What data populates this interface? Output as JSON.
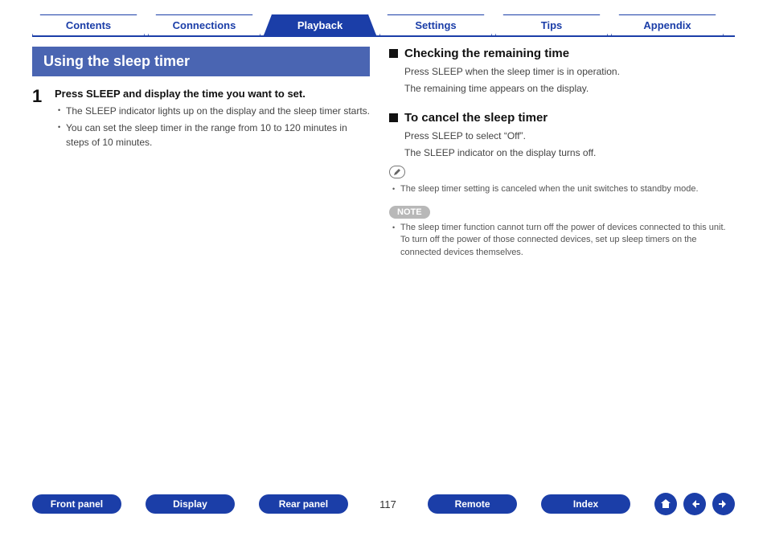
{
  "tabs": {
    "contents": "Contents",
    "connections": "Connections",
    "playback": "Playback",
    "settings": "Settings",
    "tips": "Tips",
    "appendix": "Appendix",
    "active": "playback"
  },
  "left": {
    "section_title": "Using the sleep timer",
    "step1": {
      "num": "1",
      "title": "Press SLEEP and display the time you want to set.",
      "bullets": [
        "The SLEEP indicator lights up on the display and the sleep timer starts.",
        "You can set the sleep timer in the range from 10 to 120 minutes in steps of 10 minutes."
      ]
    }
  },
  "right": {
    "sub1": {
      "title": "Checking the remaining time",
      "p1": "Press SLEEP when the sleep timer is in operation.",
      "p2": "The remaining time appears on the display."
    },
    "sub2": {
      "title": "To cancel the sleep timer",
      "p1": "Press SLEEP to select “Off”.",
      "p2": "The SLEEP indicator on the display turns off."
    },
    "tip_bullet": "The sleep timer setting is canceled when the unit switches to standby mode.",
    "note_label": "NOTE",
    "note_bullet": "The sleep timer function cannot turn off the power of devices connected to this unit. To turn off the power of those connected devices, set up sleep timers on the connected devices themselves."
  },
  "bottom": {
    "front_panel": "Front panel",
    "display": "Display",
    "rear_panel": "Rear panel",
    "page": "117",
    "remote": "Remote",
    "index": "Index"
  }
}
